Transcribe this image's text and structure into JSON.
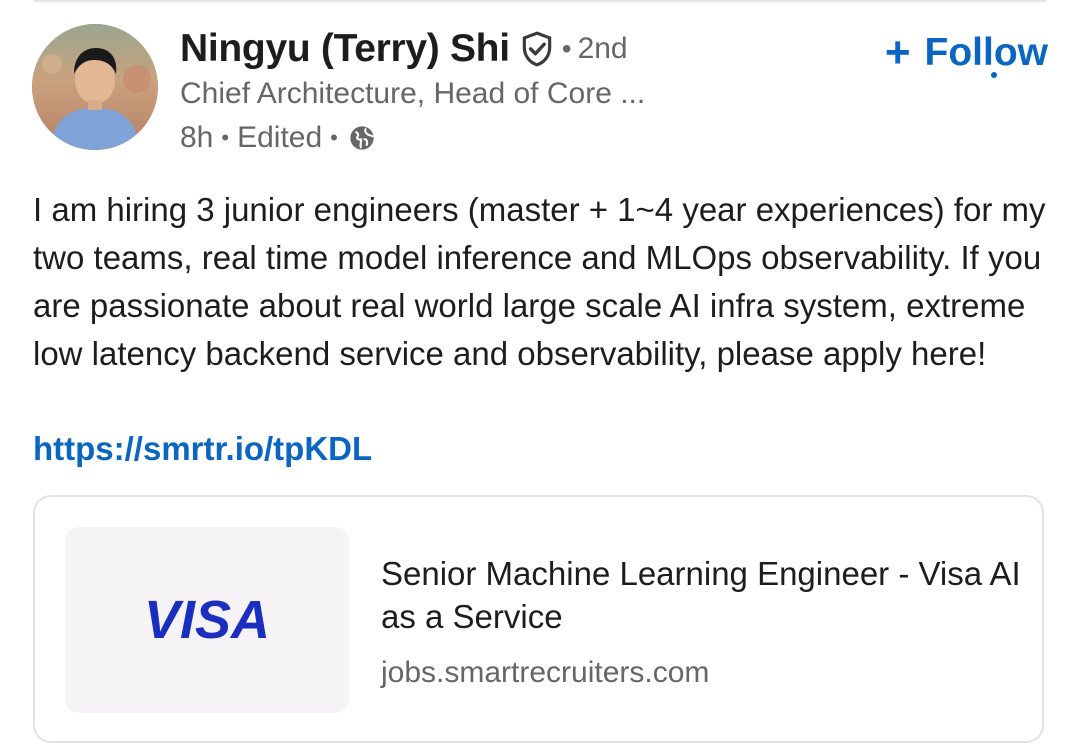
{
  "post": {
    "author": {
      "name": "Ningyu (Terry) Shi",
      "verified_icon": "verified-shield-icon",
      "dot": "•",
      "degree": "2nd",
      "headline": "Chief Architecture, Head of Core ...",
      "time": "8h",
      "edited": "Edited",
      "visibility_icon": "globe-icon"
    },
    "follow": {
      "plus": "+",
      "label": "Follow"
    },
    "body_text": "I am hiring 3 junior engineers (master + 1~4 year experiences) for my two teams, real time model inference and MLOps observability. If you are passionate about real world large scale AI infra system, extreme low latency backend service and observability, please apply here!",
    "link_text": "https://smrtr.io/tpKDL",
    "link_card": {
      "logo_text": "VISA",
      "title": "Senior Machine Learning Engineer - Visa AI as a Service",
      "domain": "jobs.smartrecruiters.com"
    }
  },
  "colors": {
    "link_blue": "#0a66c2",
    "visa_blue": "#1a2fc0",
    "secondary_text": "#666666"
  }
}
